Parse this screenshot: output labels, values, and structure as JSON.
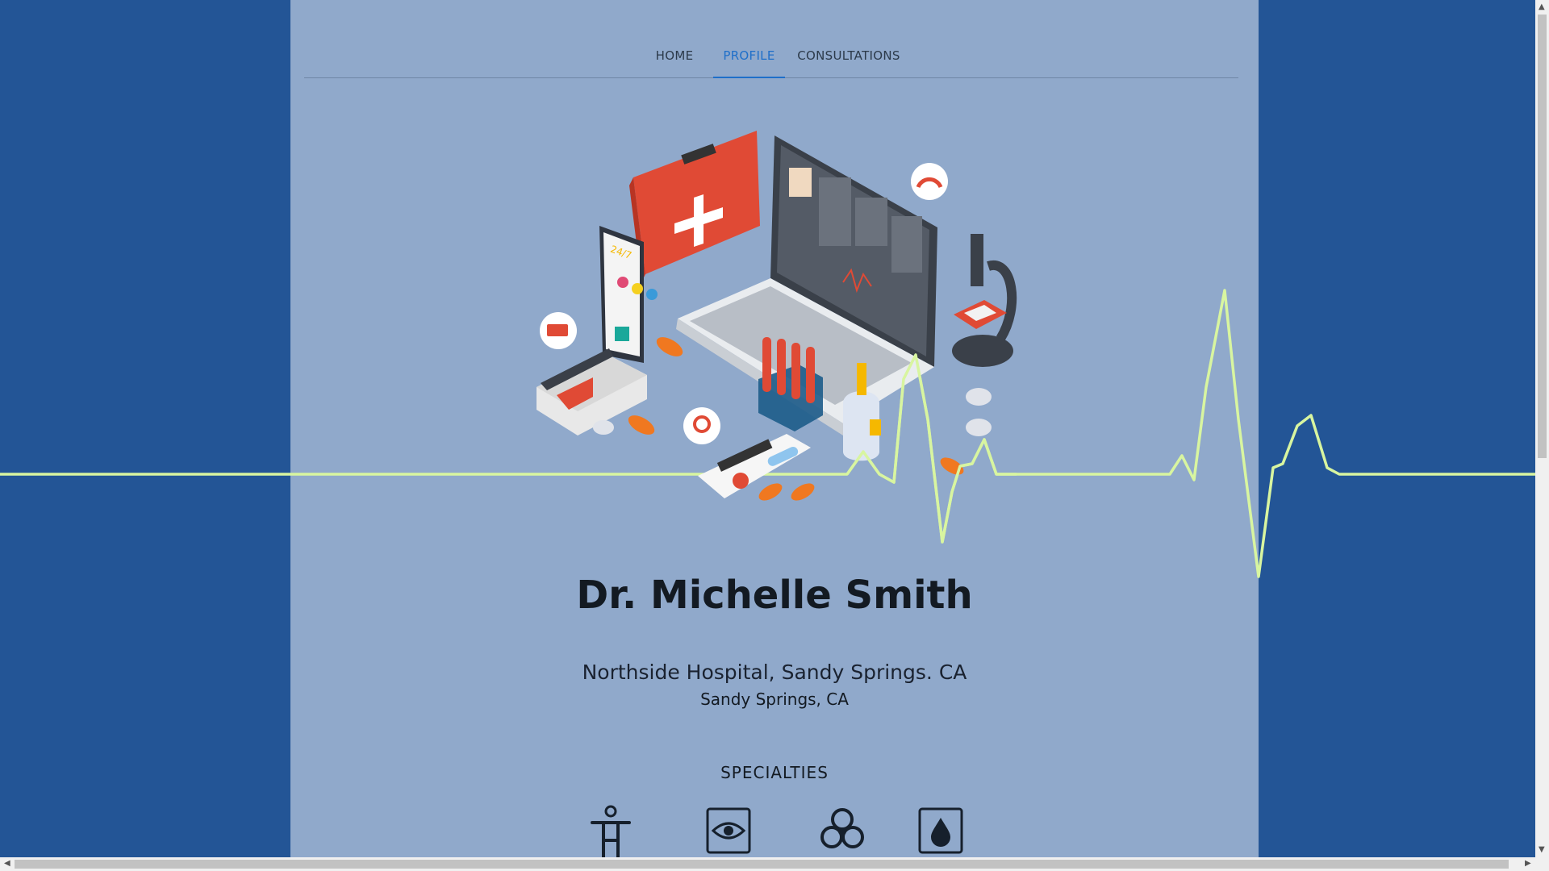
{
  "nav": {
    "tabs": [
      {
        "label": "HOME",
        "active": false
      },
      {
        "label": "PROFILE",
        "active": true
      },
      {
        "label": "CONSULTATIONS",
        "active": false
      }
    ]
  },
  "profile": {
    "name": "Dr. Michelle Smith",
    "hospital": "Northside Hospital, Sandy Springs. CA",
    "city": "Sandy Springs, CA"
  },
  "specialties": {
    "title": "SPECIALTIES",
    "icons": [
      "accessibility-icon",
      "eye-icon",
      "biohazard-icon",
      "blood-drop-icon"
    ]
  },
  "illustration": {
    "badge_text": "24/7"
  },
  "colors": {
    "page_background": "#235596",
    "content_background": "#90a9cb",
    "ekg_line": "#d8f5a0",
    "active_tab": "#1f6fc9"
  }
}
